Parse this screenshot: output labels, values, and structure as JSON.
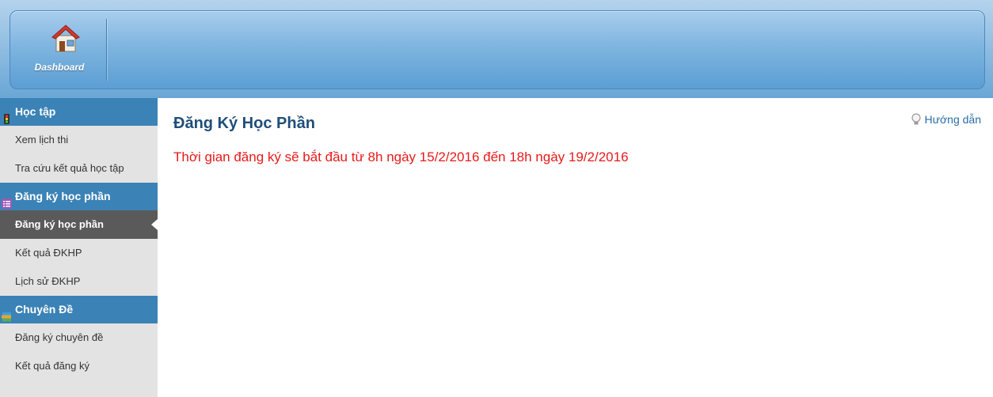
{
  "header": {
    "dashboard_label": "Dashboard"
  },
  "sidebar": {
    "sections": [
      {
        "title": "Học tập",
        "icon": "traffic-light-icon",
        "items": [
          {
            "label": "Xem lịch thi",
            "active": false
          },
          {
            "label": "Tra cứu kết quả học tập",
            "active": false
          }
        ]
      },
      {
        "title": "Đăng ký học phần",
        "icon": "list-icon",
        "items": [
          {
            "label": "Đăng ký học phần",
            "active": true
          },
          {
            "label": "Kết quả ĐKHP",
            "active": false
          },
          {
            "label": "Lịch sử ĐKHP",
            "active": false
          }
        ]
      },
      {
        "title": "Chuyên Đề",
        "icon": "stack-books-icon",
        "items": [
          {
            "label": "Đăng ký chuyên đề",
            "active": false
          },
          {
            "label": "Kết quả đăng ký",
            "active": false
          }
        ]
      }
    ]
  },
  "main": {
    "title": "Đăng Ký Học Phần",
    "notice": "Thời gian đăng ký sẽ bắt đầu từ 8h ngày 15/2/2016 đến 18h ngày 19/2/2016",
    "help_label": "Hướng dẫn"
  },
  "colors": {
    "section_header": "#3b82b6",
    "active_item": "#5a5a5a",
    "notice_text": "#e81a1a",
    "title_text": "#1f4e79"
  }
}
